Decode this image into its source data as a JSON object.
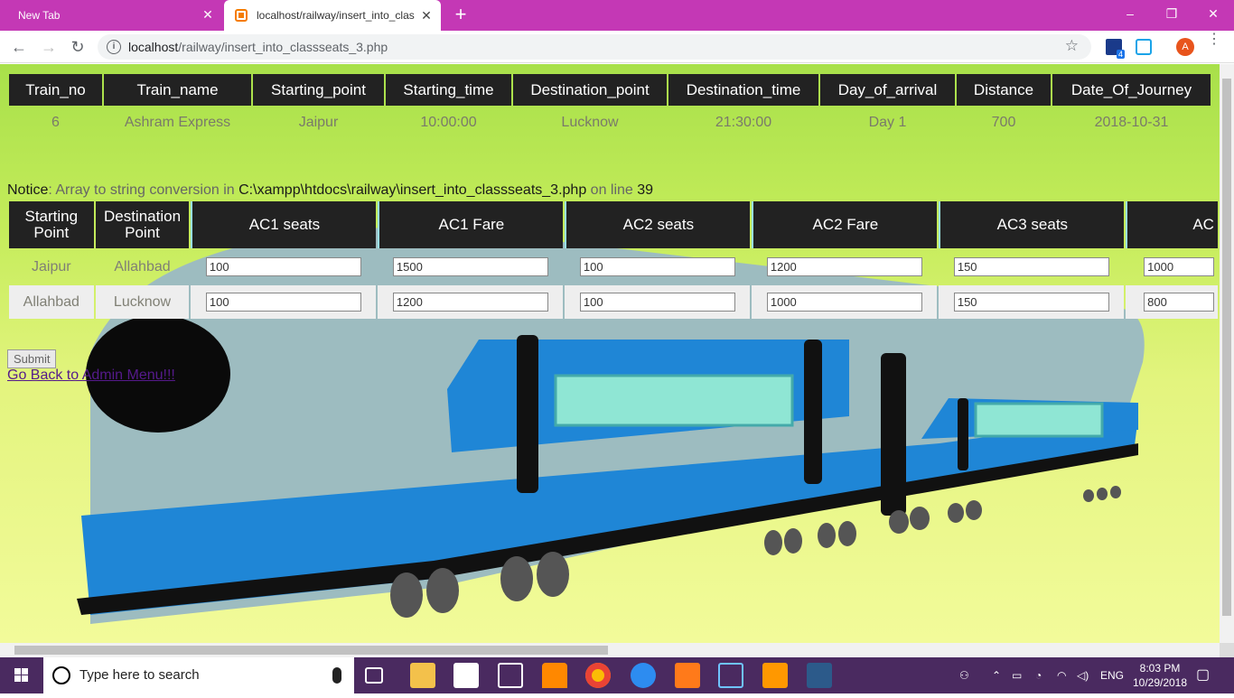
{
  "browser": {
    "tabs": [
      {
        "title": "New Tab"
      },
      {
        "title": "localhost/railway/insert_into_clas"
      }
    ],
    "url_host": "localhost",
    "url_path": "/railway/insert_into_classseats_3.php",
    "profile_initial": "A",
    "extension_badge": "4"
  },
  "trains_table": {
    "headers": [
      "Train_no",
      "Train_name",
      "Starting_point",
      "Starting_time",
      "Destination_point",
      "Destination_time",
      "Day_of_arrival",
      "Distance",
      "Date_Of_Journey"
    ],
    "row": [
      "6",
      "Ashram Express",
      "Jaipur",
      "10:00:00",
      "Lucknow",
      "21:30:00",
      "Day 1",
      "700",
      "2018-10-31"
    ]
  },
  "notice": {
    "label": "Notice",
    "message_1": ": Array to string conversion in ",
    "path": "C:\\xampp\\htdocs\\railway\\insert_into_classseats_3.php",
    "message_2": " on line ",
    "line": "39"
  },
  "seats_table": {
    "headers": [
      "Starting Point",
      "Destination Point",
      "AC1 seats",
      "AC1 Fare",
      "AC2 seats",
      "AC2 Fare",
      "AC3 seats",
      "AC"
    ],
    "rows": [
      {
        "start": "Jaipur",
        "dest": "Allahbad",
        "values": [
          "100",
          "1500",
          "100",
          "1200",
          "150",
          "1000"
        ]
      },
      {
        "start": "Allahbad",
        "dest": "Lucknow",
        "values": [
          "100",
          "1200",
          "100",
          "1000",
          "150",
          "800"
        ]
      }
    ]
  },
  "actions": {
    "submit_label": "Submit",
    "admin_link": "Go Back to Admin Menu!!!"
  },
  "taskbar": {
    "search_placeholder": "Type here to search",
    "language": "ENG",
    "time": "8:03 PM",
    "date": "10/29/2018"
  },
  "colors": {
    "tab_strip": "#c438b5",
    "header_bg": "#222222",
    "page_top": "#a8e04a",
    "page_bottom": "#f2fb9a",
    "train_blue": "#1f86d6",
    "taskbar": "#4a2a60"
  }
}
